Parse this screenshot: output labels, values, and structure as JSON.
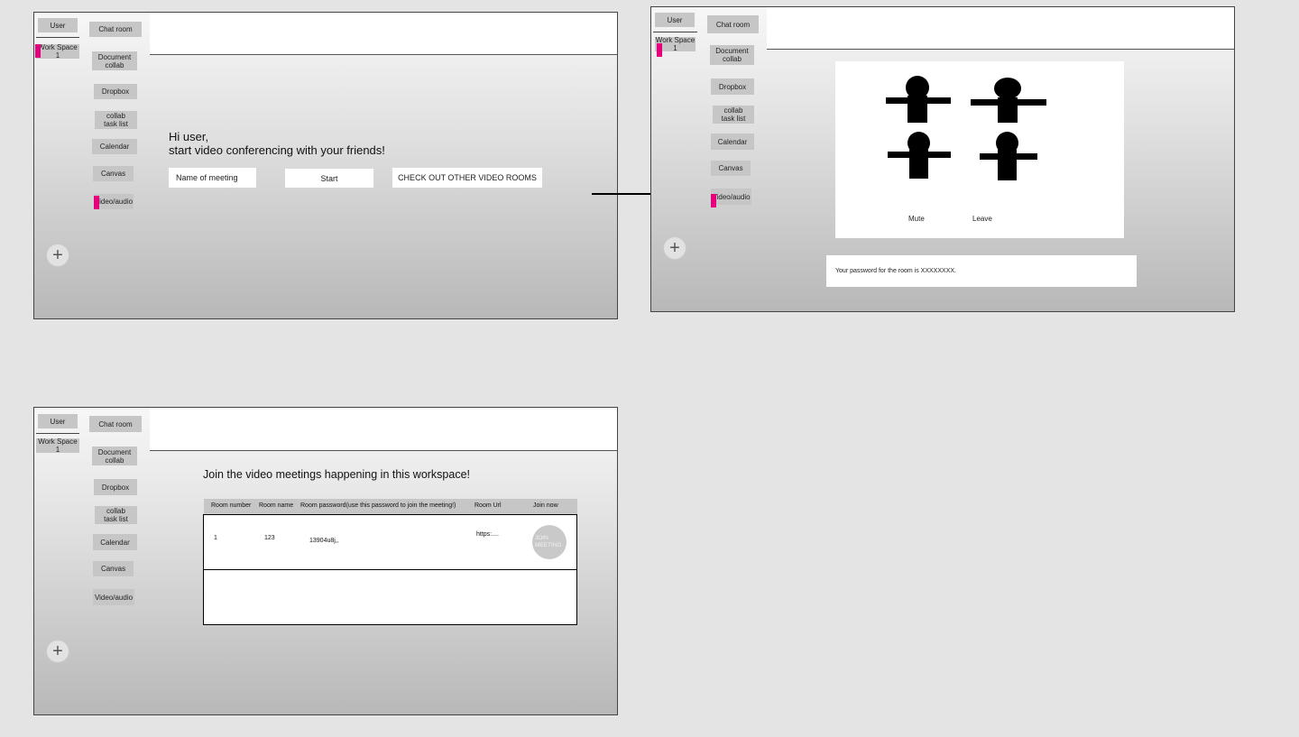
{
  "sidebar": {
    "user_label": "User",
    "workspace_label": "Work Space 1",
    "nav_items": [
      "Chat room",
      "Document\ncollab",
      "Dropbox",
      "collab\ntask list",
      "Calendar",
      "Canvas",
      "Video/audio"
    ],
    "add_symbol": "+"
  },
  "frame_start": {
    "greeting_line1": "Hi user,",
    "greeting_line2": "start video conferencing with your friends!",
    "meeting_name_placeholder": "Name of meeting",
    "start_label": "Start",
    "other_rooms_label": "CHECK OUT OTHER VIDEO ROOMS"
  },
  "frame_call": {
    "participants": 4,
    "mute_label": "Mute",
    "leave_label": "Leave",
    "password_message": "Your password for the room is XXXXXXXX."
  },
  "frame_rooms": {
    "heading": "Join the video meetings happening in this workspace!",
    "columns": [
      "Room number",
      "Room name",
      "Room password(use this password to join the meeting!)",
      "Room Url",
      "Join now"
    ],
    "rows": [
      {
        "number": "1",
        "name": "123",
        "password": "13904u8j,,",
        "url": "https:....",
        "join_label": "JOIN\nMEETING"
      }
    ]
  },
  "colors": {
    "highlight_marker": "#e6007e",
    "chip": "#c6c6c6",
    "canvas": "#e4e4e4"
  }
}
